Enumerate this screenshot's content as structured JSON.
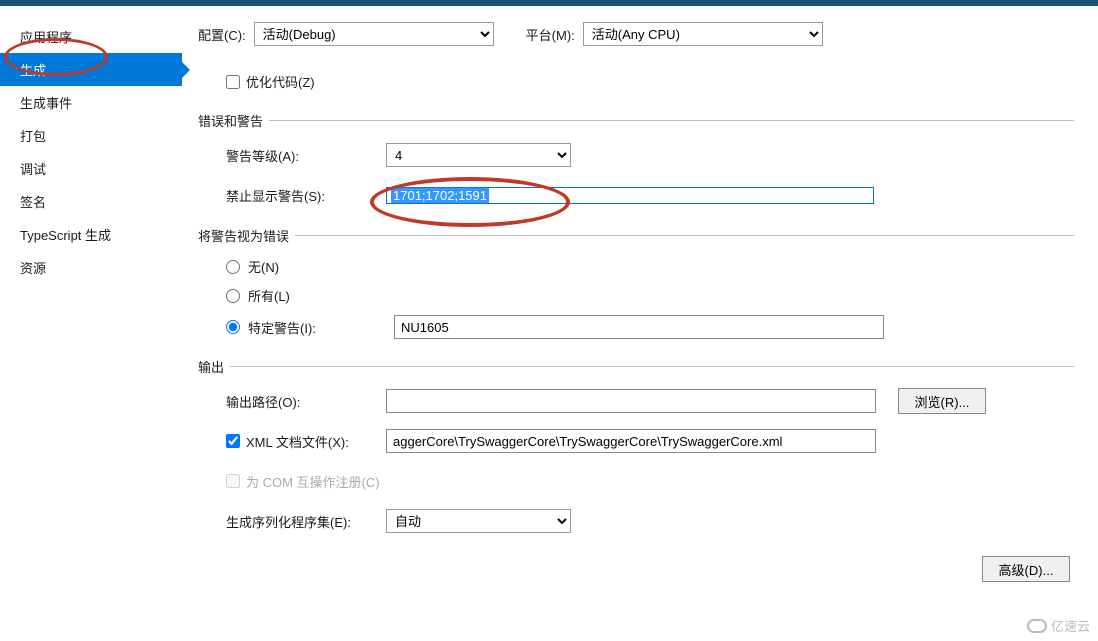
{
  "sidebar": {
    "items": [
      {
        "label": "应用程序"
      },
      {
        "label": "生成"
      },
      {
        "label": "生成事件"
      },
      {
        "label": "打包"
      },
      {
        "label": "调试"
      },
      {
        "label": "签名"
      },
      {
        "label": "TypeScript 生成"
      },
      {
        "label": "资源"
      }
    ]
  },
  "config": {
    "config_label": "配置(C):",
    "config_value": "活动(Debug)",
    "platform_label": "平台(M):",
    "platform_value": "活动(Any CPU)"
  },
  "optimize": {
    "label": "优化代码(Z)"
  },
  "errors_warnings": {
    "title": "错误和警告",
    "warn_level_label": "警告等级(A):",
    "warn_level_value": "4",
    "suppress_label": "禁止显示警告(S):",
    "suppress_value": "1701;1702;1591"
  },
  "treat_as_errors": {
    "title": "将警告视为错误",
    "none_label": "无(N)",
    "all_label": "所有(L)",
    "specific_label": "特定警告(I):",
    "specific_value": "NU1605"
  },
  "output": {
    "title": "输出",
    "path_label": "输出路径(O):",
    "path_value": "",
    "browse_label": "浏览(R)...",
    "xml_doc_label": "XML 文档文件(X):",
    "xml_doc_value": "aggerCore\\TrySwaggerCore\\TrySwaggerCore\\TrySwaggerCore.xml",
    "com_label": "为 COM 互操作注册(C)",
    "serialization_label": "生成序列化程序集(E):",
    "serialization_value": "自动"
  },
  "advanced": {
    "label": "高级(D)..."
  },
  "watermark": {
    "text": "亿速云"
  }
}
